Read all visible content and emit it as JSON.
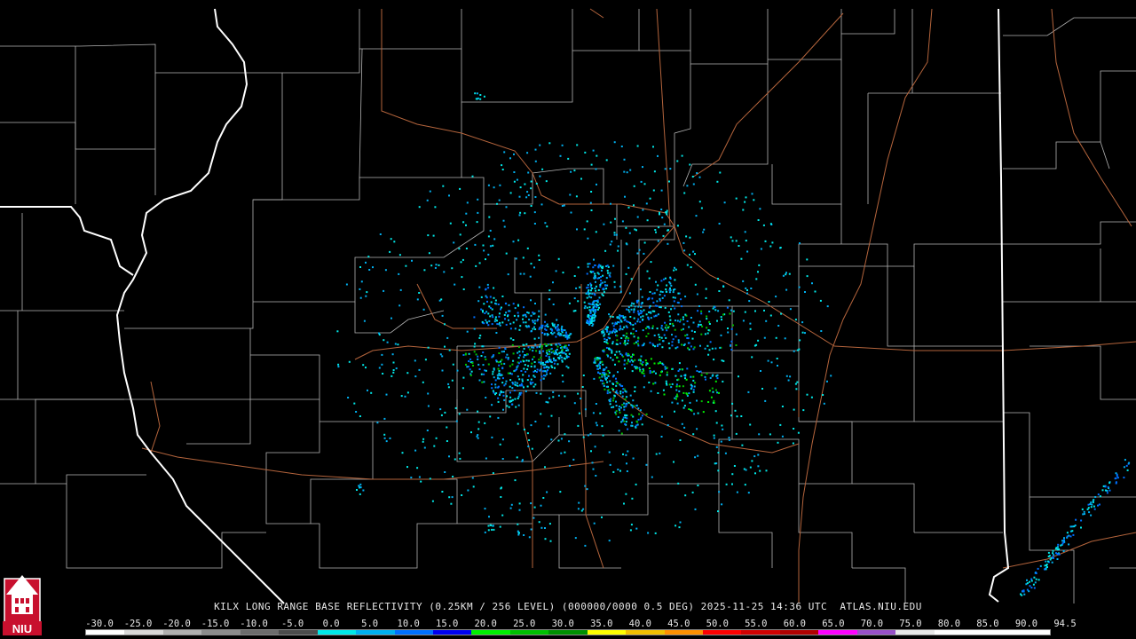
{
  "map": {
    "title_parts": [
      "KILX",
      "LONG",
      "RANGE",
      "BASE",
      "REFLECTIVITY",
      "(0.25KM / 256 LEVEL)",
      "(000000/0000",
      "0.5 DEG)",
      "2025-11-25",
      "14:36",
      "UTC",
      "ATLAS.NIU.EDU"
    ],
    "logo_text": "NIU",
    "colors": {
      "background": "#000000",
      "county_border": "#b4b4b4",
      "state_border": "#ffffff",
      "highway": "#b4643c"
    }
  },
  "scale": {
    "labels": [
      "-30.0",
      "-25.0",
      "-20.0",
      "-15.0",
      "-10.0",
      "-5.0",
      "0.0",
      "5.0",
      "10.0",
      "15.0",
      "20.0",
      "25.0",
      "30.0",
      "35.0",
      "40.0",
      "45.0",
      "50.0",
      "55.0",
      "60.0",
      "65.0",
      "70.0",
      "75.0",
      "80.0",
      "85.0",
      "90.0",
      "94.5"
    ],
    "colors": [
      "#ffffff",
      "#d8d8d8",
      "#b0b0b0",
      "#8c8c8c",
      "#6c6c6c",
      "#4c4c4c",
      "#00e8e8",
      "#00b0f0",
      "#0070ff",
      "#0000f0",
      "#00f000",
      "#00c000",
      "#009000",
      "#ffff00",
      "#f0c000",
      "#ff9000",
      "#ff0000",
      "#d00000",
      "#b00000",
      "#ff00ff",
      "#9850c8",
      "#e8e8e8",
      "#ffffff",
      "#ffffff",
      "#ffffff"
    ]
  },
  "echoes": {
    "center": {
      "lon": 660,
      "lat": 385
    },
    "spokes": [
      {
        "angle": -6,
        "length": 150,
        "level": 3
      },
      {
        "angle": 168,
        "length": 120,
        "level": 3
      },
      {
        "angle": 24,
        "length": 140,
        "level": 4
      },
      {
        "angle": 60,
        "length": 90,
        "level": 3
      },
      {
        "angle": 200,
        "length": 110,
        "level": 2
      },
      {
        "angle": 280,
        "length": 70,
        "level": 2
      },
      {
        "angle": 330,
        "length": 100,
        "level": 2
      },
      {
        "angle": 150,
        "length": 100,
        "level": 2
      }
    ]
  }
}
